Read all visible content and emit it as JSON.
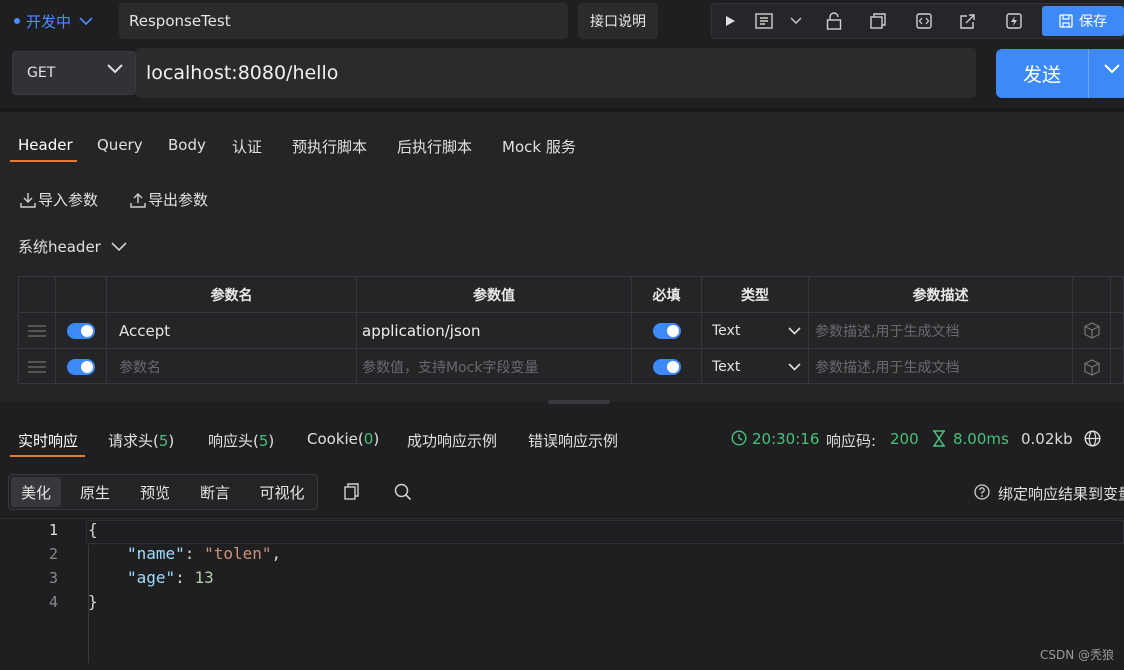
{
  "top": {
    "env_label": "开发中",
    "api_name": "ResponseTest",
    "doc_label": "接口说明",
    "save_label": "保存"
  },
  "request": {
    "method": "GET",
    "url": "localhost:8080/hello",
    "send_label": "发送"
  },
  "tabs": [
    "Header",
    "Query",
    "Body",
    "认证",
    "预执行脚本",
    "后执行脚本",
    "Mock 服务"
  ],
  "actions": {
    "import": "导入参数",
    "export": "导出参数",
    "system_header": "系统header"
  },
  "table": {
    "headers": [
      "参数名",
      "参数值",
      "必填",
      "类型",
      "参数描述"
    ],
    "rows": [
      {
        "name": "Accept",
        "value": "application/json",
        "type": "Text",
        "desc_placeholder": "参数描述,用于生成文档"
      },
      {
        "name_placeholder": "参数名",
        "value_placeholder": "参数值，支持Mock字段变量",
        "type": "Text",
        "desc_placeholder": "参数描述,用于生成文档"
      }
    ]
  },
  "response": {
    "tabs": {
      "realtime": "实时响应",
      "req_headers": "请求头(",
      "req_headers_count": "5",
      "resp_headers": "响应头(",
      "resp_headers_count": "5",
      "cookie": "Cookie(",
      "cookie_count": "0",
      "close_paren": ")",
      "success_example": "成功响应示例",
      "error_example": "错误响应示例"
    },
    "time": "20:30:16",
    "code_label": "响应码:",
    "code": "200",
    "duration": "8.00ms",
    "size": "0.02kb",
    "format_buttons": [
      "美化",
      "原生",
      "预览",
      "断言",
      "可视化"
    ],
    "bind_label": "绑定响应结果到变量",
    "body_lines": [
      "1",
      "2",
      "3",
      "4"
    ],
    "json": {
      "open": "{",
      "key1": "\"name\"",
      "val1": "\"tolen\"",
      "key2": "\"age\"",
      "val2": "13",
      "close": "}"
    }
  },
  "watermark": "CSDN @秃狼",
  "colors": {
    "accent": "#3d8af7",
    "tab_underline": "#e87a33",
    "success": "#47c27a"
  }
}
